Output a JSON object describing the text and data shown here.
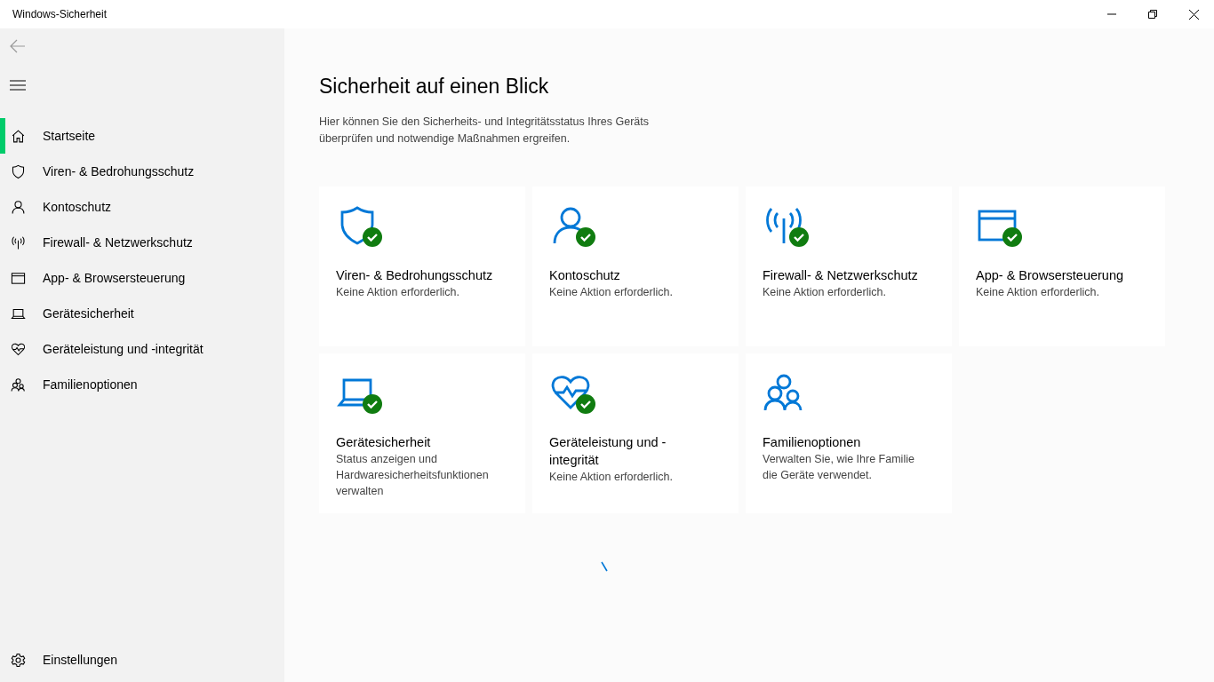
{
  "window": {
    "title": "Windows-Sicherheit"
  },
  "sidebar": {
    "items": [
      {
        "kind": "home",
        "label": "Startseite",
        "selected": true
      },
      {
        "kind": "shield",
        "label": "Viren- & Bedrohungsschutz",
        "selected": false
      },
      {
        "kind": "person",
        "label": "Kontoschutz",
        "selected": false
      },
      {
        "kind": "antenna",
        "label": "Firewall- & Netzwerkschutz",
        "selected": false
      },
      {
        "kind": "browser",
        "label": "App- & Browsersteuerung",
        "selected": false
      },
      {
        "kind": "laptop",
        "label": "Gerätesicherheit",
        "selected": false
      },
      {
        "kind": "heart",
        "label": "Geräteleistung und -integrität",
        "selected": false
      },
      {
        "kind": "family",
        "label": "Familienoptionen",
        "selected": false
      }
    ],
    "settings": {
      "label": "Einstellungen"
    }
  },
  "main": {
    "title": "Sicherheit auf einen Blick",
    "description": "Hier können Sie den Sicherheits- und Integritätsstatus Ihres Geräts überprüfen und notwendige Maßnahmen ergreifen.",
    "cards": [
      {
        "kind": "shield",
        "title": "Viren- & Bedrohungsschutz",
        "text": "Keine Aktion erforderlich.",
        "ok": true
      },
      {
        "kind": "person",
        "title": "Kontoschutz",
        "text": "Keine Aktion erforderlich.",
        "ok": true
      },
      {
        "kind": "antenna",
        "title": "Firewall- & Netzwerkschutz",
        "text": "Keine Aktion erforderlich.",
        "ok": true
      },
      {
        "kind": "browser",
        "title": "App- & Browsersteuerung",
        "text": "Keine Aktion erforderlich.",
        "ok": true
      },
      {
        "kind": "laptop",
        "title": "Gerätesicherheit",
        "text": "Status anzeigen und Hardwaresicherheitsfunktionen verwalten",
        "ok": true
      },
      {
        "kind": "heart",
        "title": "Geräteleistung und - integrität",
        "text": "Keine Aktion erforderlich.",
        "ok": true
      },
      {
        "kind": "family",
        "title": "Familienoptionen",
        "text": "Verwalten Sie, wie Ihre Familie die Geräte verwendet.",
        "ok": false
      }
    ]
  }
}
